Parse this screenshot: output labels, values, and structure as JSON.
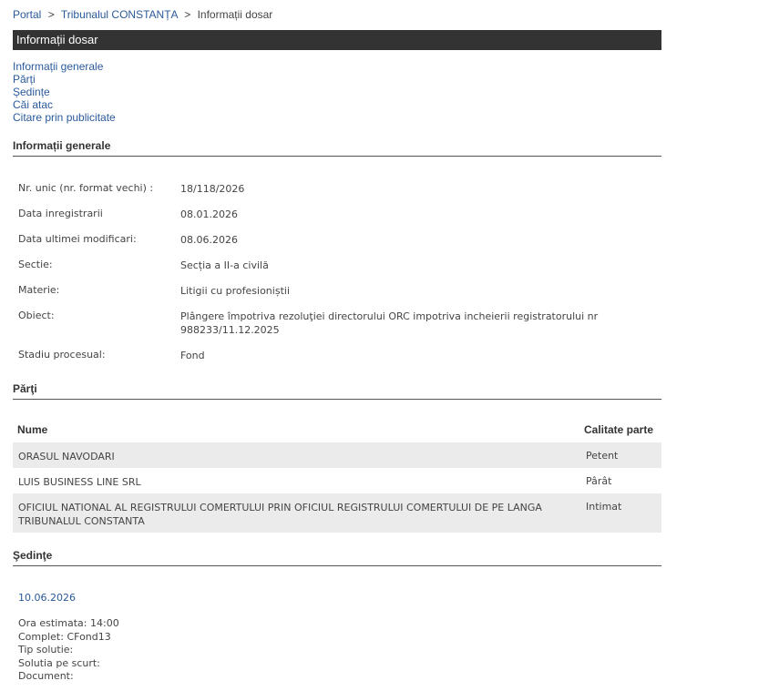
{
  "breadcrumb": {
    "portal": "Portal",
    "sep1": ">",
    "court": "Tribunalul CONSTANȚA",
    "sep2": ">",
    "current": "Informații dosar"
  },
  "title_bar": "Informații dosar",
  "nav": {
    "items": [
      "Informații generale",
      "Părți",
      "Ședințe",
      "Căi atac",
      "Citare prin publicitate"
    ]
  },
  "general": {
    "heading": "Informații generale",
    "rows": [
      {
        "label": "Nr. unic (nr. format vechi) :",
        "value": "18/118/2026"
      },
      {
        "label": "Data inregistrarii",
        "value": "08.01.2026"
      },
      {
        "label": "Data ultimei modificari:",
        "value": "08.06.2026"
      },
      {
        "label": "Sectie:",
        "value": "Secția a II-a civilă"
      },
      {
        "label": "Materie:",
        "value": "Litigii cu profesioniștii"
      },
      {
        "label": "Obiect:",
        "value": "Plângere împotriva rezoluţiei directorului ORC impotriva incheierii registratorului nr 988233/11.12.2025"
      },
      {
        "label": "Stadiu procesual:",
        "value": "Fond"
      }
    ]
  },
  "parties": {
    "heading": "Părţi",
    "col_name": "Nume",
    "col_role": "Calitate parte",
    "rows": [
      {
        "name": "ORASUL NAVODARI",
        "role": "Petent"
      },
      {
        "name": "LUIS BUSINESS LINE SRL",
        "role": "Pârât"
      },
      {
        "name": "OFICIUL NATIONAL AL REGISTRULUI COMERTULUI PRIN OFICIUL REGISTRULUI COMERTULUI DE PE LANGA TRIBUNALUL CONSTANTA",
        "role": "Intimat"
      }
    ]
  },
  "sessions": {
    "heading": "Şedinţe",
    "date": "10.06.2026",
    "lines": [
      "Ora estimata: 14:00",
      "Complet: CFond13",
      "Tip solutie:",
      "Solutia pe scurt:",
      "Document:"
    ]
  },
  "colors": {
    "link": "#2a5a9b",
    "title_bar_bg": "#333333",
    "alt_row_bg": "#ebebeb"
  }
}
